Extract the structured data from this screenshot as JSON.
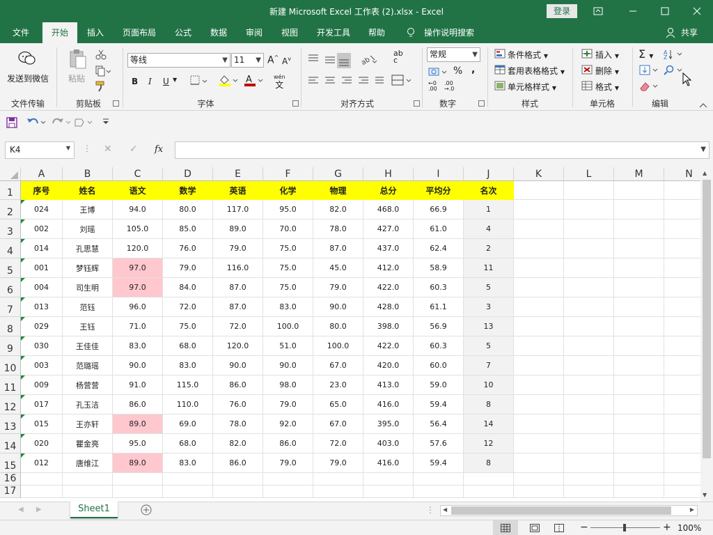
{
  "title": "新建 Microsoft Excel 工作表 (2).xlsx  -  Excel",
  "login_label": "登录",
  "tabs": [
    "文件",
    "开始",
    "插入",
    "页面布局",
    "公式",
    "数据",
    "审阅",
    "视图",
    "开发工具",
    "帮助"
  ],
  "tell_me": "操作说明搜索",
  "share_label": "共享",
  "ribbon": {
    "send_wechat": "发送到微信",
    "paste": "粘贴",
    "font_name": "等线",
    "font_size": "11",
    "bold": "B",
    "italic": "I",
    "underline": "U",
    "font_color_glyph": "A",
    "wen": "wén",
    "wen_char": "文",
    "ab": "ab",
    "ac": "c",
    "number_format": "常规",
    "percent": "%",
    "comma": ",",
    "dec1": "←0\n.00",
    "dec2": ".00\n→.0",
    "conditional": "条件格式",
    "table_format": "套用表格格式",
    "cell_style": "单元格样式",
    "insert": "插入",
    "delete": "删除",
    "format": "格式",
    "groups": [
      "文件传输",
      "剪贴板",
      "字体",
      "对齐方式",
      "数字",
      "样式",
      "单元格",
      "编辑"
    ]
  },
  "formula_bar": {
    "name_box": "K4",
    "fx": "fx",
    "value": ""
  },
  "columns": [
    "A",
    "B",
    "C",
    "D",
    "E",
    "F",
    "G",
    "H",
    "I",
    "J",
    "K",
    "L",
    "M",
    "N"
  ],
  "rows": [
    "1",
    "2",
    "3",
    "4",
    "5",
    "6",
    "7",
    "8",
    "9",
    "10",
    "11",
    "12",
    "13",
    "14",
    "15",
    "16",
    "17"
  ],
  "headers": [
    "序号",
    "姓名",
    "语文",
    "数学",
    "英语",
    "化学",
    "物理",
    "总分",
    "平均分",
    "名次"
  ],
  "data": [
    [
      "024",
      "王博",
      "94.0",
      "80.0",
      "117.0",
      "95.0",
      "82.0",
      "468.0",
      "66.9",
      "1"
    ],
    [
      "002",
      "刘瑶",
      "105.0",
      "85.0",
      "89.0",
      "70.0",
      "78.0",
      "427.0",
      "61.0",
      "4"
    ],
    [
      "014",
      "孔思慧",
      "120.0",
      "76.0",
      "79.0",
      "75.0",
      "87.0",
      "437.0",
      "62.4",
      "2"
    ],
    [
      "001",
      "梦钰辉",
      "97.0",
      "79.0",
      "116.0",
      "75.0",
      "45.0",
      "412.0",
      "58.9",
      "11"
    ],
    [
      "004",
      "司生明",
      "97.0",
      "84.0",
      "87.0",
      "75.0",
      "79.0",
      "422.0",
      "60.3",
      "5"
    ],
    [
      "013",
      "范钰",
      "96.0",
      "72.0",
      "87.0",
      "83.0",
      "90.0",
      "428.0",
      "61.1",
      "3"
    ],
    [
      "029",
      "王钰",
      "71.0",
      "75.0",
      "72.0",
      "100.0",
      "80.0",
      "398.0",
      "56.9",
      "13"
    ],
    [
      "030",
      "王佳佳",
      "83.0",
      "68.0",
      "120.0",
      "51.0",
      "100.0",
      "422.0",
      "60.3",
      "5"
    ],
    [
      "003",
      "范璐瑶",
      "90.0",
      "83.0",
      "90.0",
      "90.0",
      "67.0",
      "420.0",
      "60.0",
      "7"
    ],
    [
      "009",
      "杨营营",
      "91.0",
      "115.0",
      "86.0",
      "98.0",
      "23.0",
      "413.0",
      "59.0",
      "10"
    ],
    [
      "017",
      "孔玉洁",
      "86.0",
      "110.0",
      "76.0",
      "79.0",
      "65.0",
      "416.0",
      "59.4",
      "8"
    ],
    [
      "015",
      "王亦轩",
      "89.0",
      "69.0",
      "78.0",
      "92.0",
      "67.0",
      "395.0",
      "56.4",
      "14"
    ],
    [
      "020",
      "瞿金亮",
      "95.0",
      "68.0",
      "82.0",
      "86.0",
      "72.0",
      "403.0",
      "57.6",
      "12"
    ],
    [
      "012",
      "唐维江",
      "89.0",
      "83.0",
      "86.0",
      "79.0",
      "79.0",
      "416.0",
      "59.4",
      "8"
    ]
  ],
  "highlighted_cells": [
    "C5",
    "C6",
    "C13",
    "C15"
  ],
  "sheet_tab": "Sheet1",
  "zoom": "100%",
  "zoom_minus": "−",
  "zoom_plus": "+",
  "colors": {
    "excel_green": "#217346",
    "header_yellow": "#ffff00",
    "highlight_pink": "#ffc7ce"
  }
}
